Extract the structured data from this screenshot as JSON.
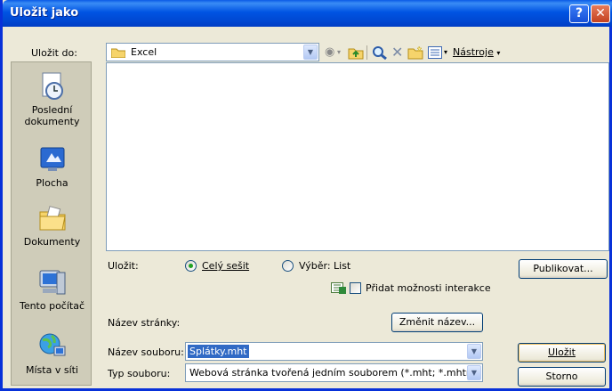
{
  "window": {
    "title": "Uložit jako"
  },
  "titlebar": {
    "help_glyph": "?",
    "close_glyph": "✕"
  },
  "save_in": {
    "label": "Uložit do:",
    "accel": "l",
    "value": "Excel"
  },
  "toolbar": {
    "tools_label": "Nástroje",
    "tools_accel": "N"
  },
  "places": [
    {
      "label": "Poslední dokumenty",
      "icon": "recent-documents-icon"
    },
    {
      "label": "Plocha",
      "icon": "desktop-icon"
    },
    {
      "label": "Dokumenty",
      "icon": "documents-folder-icon"
    },
    {
      "label": "Tento počítač",
      "icon": "my-computer-icon"
    },
    {
      "label": "Místa v síti",
      "icon": "network-places-icon"
    }
  ],
  "save_options": {
    "label": "Uložit:",
    "whole_workbook": "Celý sešit",
    "selection": "Výběr: List",
    "publish_button": "Publikovat...",
    "add_interactivity": "Přidat možnosti interakce",
    "whole_workbook_selected": true,
    "interactivity_checked": false
  },
  "page_title": {
    "label": "Název stránky:",
    "change_button": "Změnit název..."
  },
  "filename": {
    "label": "Název souboru:",
    "value": "Splátky.mht"
  },
  "filetype": {
    "label": "Typ souboru:",
    "value": "Webová stránka tvořená jedním souborem (*.mht; *.mhtml)"
  },
  "buttons": {
    "save": "Uložit",
    "cancel": "Storno"
  },
  "colors": {
    "title_bar": "#0054e3",
    "window_face": "#ece9d8",
    "places_bar": "#cfccb9",
    "selection": "#316ac5"
  }
}
